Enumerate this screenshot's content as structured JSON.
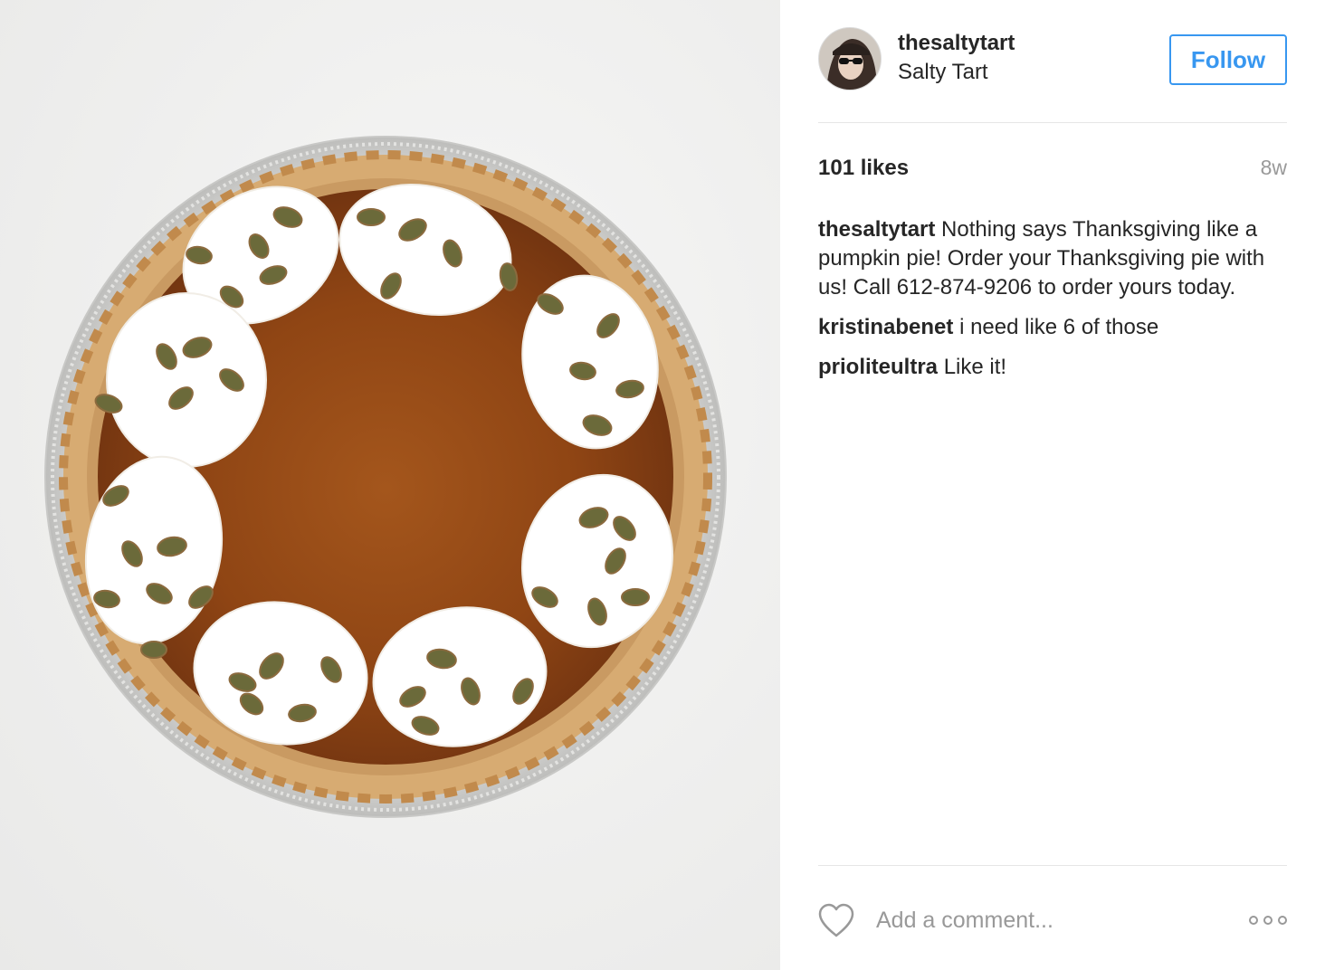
{
  "photo": {
    "alt": "pumpkin pie with whipped cream and pepitas",
    "colors": {
      "background": "#efefee",
      "filling": "#9a4a17",
      "crust": "#d9b07a",
      "cream": "#ffffff",
      "seeds": "#6b6a3a"
    }
  },
  "header": {
    "avatar_icon": "avatar-icon",
    "username": "thesaltytart",
    "full_name": "Salty Tart",
    "follow_label": "Follow"
  },
  "stats": {
    "likes": "101 likes",
    "age": "8w"
  },
  "comments": [
    {
      "user": "thesaltytart",
      "text": "Nothing says Thanksgiving like a pumpkin pie! Order your Thanksgiving pie with us! Call 612-874-9206 to order yours today."
    },
    {
      "user": "kristinabenet",
      "text": "i need like 6 of those"
    },
    {
      "user": "prioliteultra",
      "text": "Like it!"
    }
  ],
  "footer": {
    "heart_icon": "heart-outline-icon",
    "comment_placeholder": "Add a comment...",
    "more_icon": "more-options-icon"
  },
  "colors": {
    "accent": "#3897f0",
    "text": "#262626",
    "muted": "#999999",
    "divider": "#e6e6e6"
  }
}
